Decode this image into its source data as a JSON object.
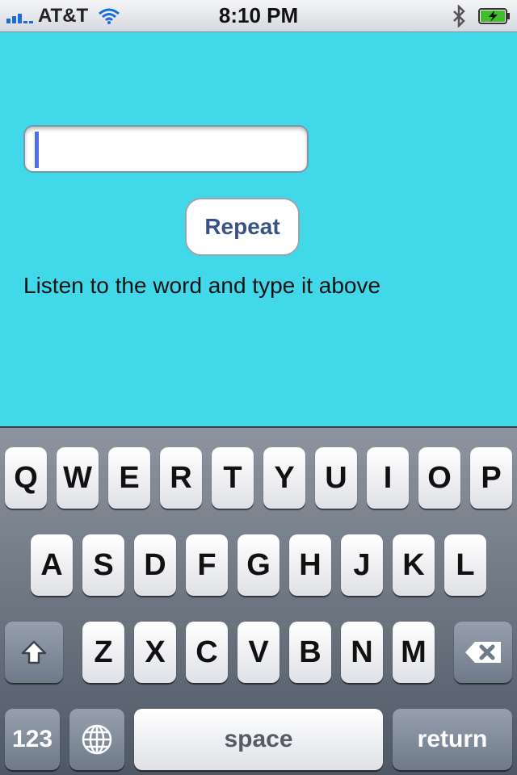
{
  "status_bar": {
    "carrier": "AT&T",
    "time": "8:10 PM",
    "signal_bars": 3,
    "battery_state": "charging"
  },
  "content": {
    "answer_field_value": "",
    "repeat_label": "Repeat",
    "instruction": "Listen to the word and type it above"
  },
  "keyboard": {
    "row1": [
      "Q",
      "W",
      "E",
      "R",
      "T",
      "Y",
      "U",
      "I",
      "O",
      "P"
    ],
    "row2": [
      "A",
      "S",
      "D",
      "F",
      "G",
      "H",
      "J",
      "K",
      "L"
    ],
    "row3": [
      "Z",
      "X",
      "C",
      "V",
      "B",
      "N",
      "M"
    ],
    "numbers_label": "123",
    "space_label": "space",
    "return_label": "return"
  },
  "colors": {
    "background": "#41d9ea",
    "caret": "#4a6df2",
    "button_text": "#3a5386"
  }
}
